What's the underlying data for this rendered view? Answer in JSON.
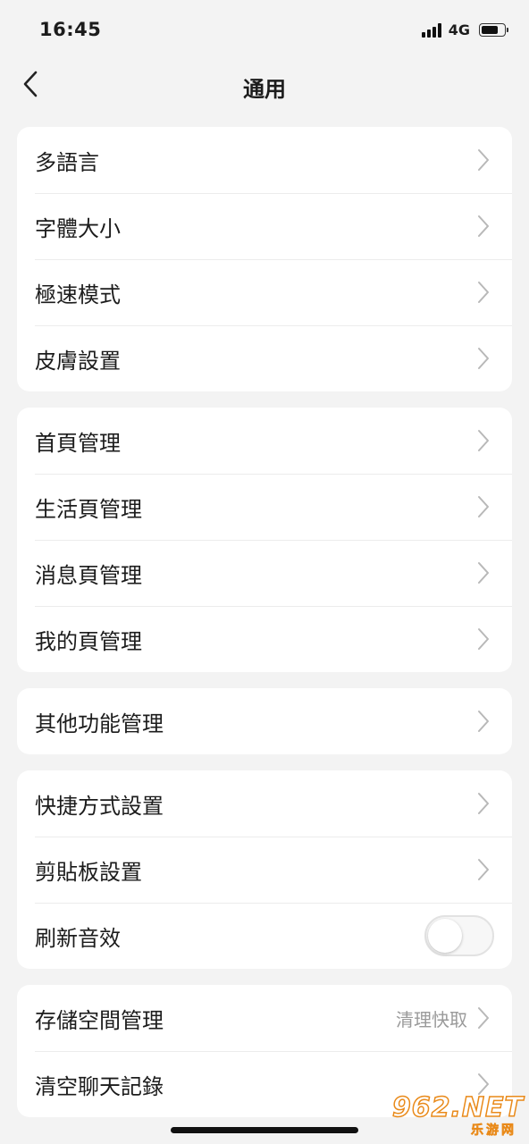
{
  "status_bar": {
    "time": "16:45",
    "network": "4G",
    "battery_level": 0.8
  },
  "nav": {
    "title": "通用",
    "back_icon": "chevron-left-icon"
  },
  "groups": [
    {
      "items": [
        {
          "label": "多語言",
          "type": "link"
        },
        {
          "label": "字體大小",
          "type": "link"
        },
        {
          "label": "極速模式",
          "type": "link"
        },
        {
          "label": "皮膚設置",
          "type": "link"
        }
      ]
    },
    {
      "items": [
        {
          "label": "首頁管理",
          "type": "link"
        },
        {
          "label": "生活頁管理",
          "type": "link"
        },
        {
          "label": "消息頁管理",
          "type": "link"
        },
        {
          "label": "我的頁管理",
          "type": "link"
        }
      ]
    },
    {
      "items": [
        {
          "label": "其他功能管理",
          "type": "link"
        }
      ]
    },
    {
      "items": [
        {
          "label": "快捷方式設置",
          "type": "link"
        },
        {
          "label": "剪貼板設置",
          "type": "link"
        },
        {
          "label": "刷新音效",
          "type": "toggle",
          "on": false
        }
      ]
    },
    {
      "items": [
        {
          "label": "存儲空間管理",
          "type": "link",
          "value": "清理快取"
        },
        {
          "label": "清空聊天記錄",
          "type": "link"
        }
      ]
    }
  ],
  "watermark": {
    "top": "962.NET",
    "bottom": "乐游网"
  },
  "colors": {
    "background": "#f3f3f3",
    "card": "#ffffff",
    "text": "#1c1c1c",
    "secondary_text": "#9a9a9a",
    "chevron": "#b8b8b8"
  }
}
